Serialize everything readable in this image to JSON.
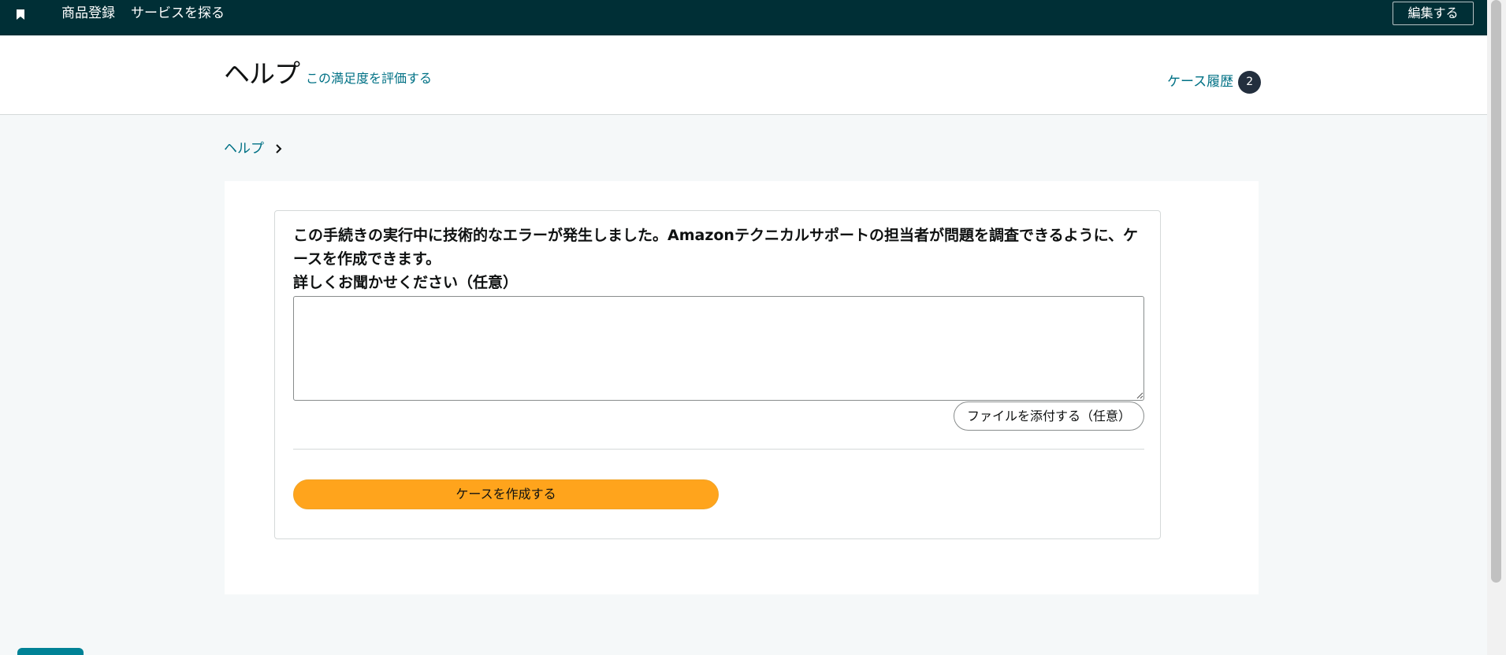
{
  "topnav": {
    "bookmark_icon": "bookmark-icon",
    "items": [
      "商品登録",
      "サービスを探る"
    ],
    "edit_label": "編集する"
  },
  "header": {
    "title": "ヘルプ",
    "rate_link": "この満足度を評価する",
    "case_history_label": "ケース履歴",
    "case_history_count": "2"
  },
  "breadcrumb": {
    "items": [
      "ヘルプ"
    ],
    "separator_icon": "chevron-right-icon"
  },
  "form": {
    "error_message": "この手続きの実行中に技術的なエラーが発生しました。Amazonテクニカルサポートの担当者が問題を調査できるように、ケースを作成できます。",
    "details_label": "詳しくお聞かせください（任意）",
    "details_value": "",
    "attach_label": "ファイルを添付する（任意）",
    "create_case_label": "ケースを作成する"
  },
  "colors": {
    "nav_bg": "#002f36",
    "link": "#007185",
    "primary_button": "#ffa41c",
    "badge_bg": "#232f3e",
    "page_bg": "#f5f8f9"
  }
}
